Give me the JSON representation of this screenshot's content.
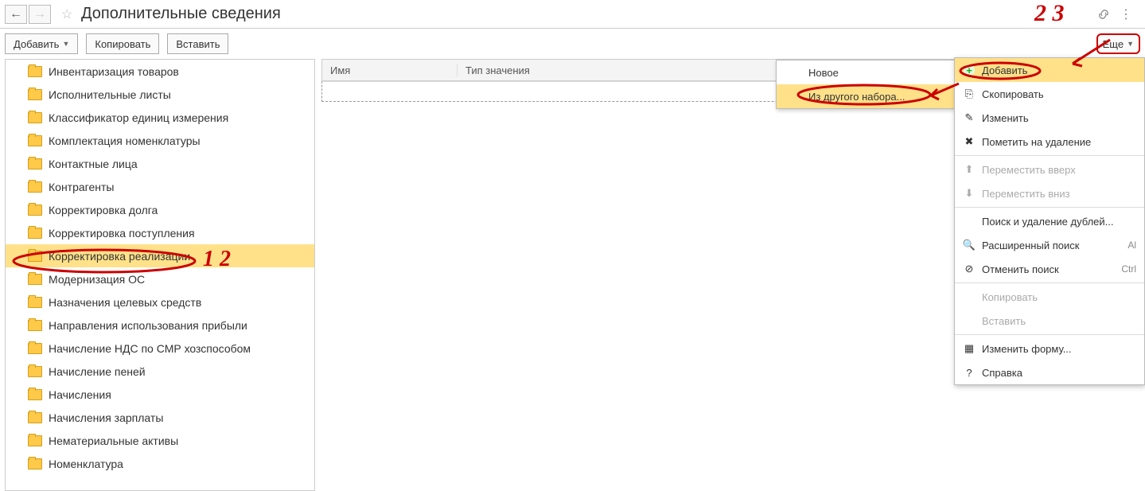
{
  "header": {
    "title": "Дополнительные сведения"
  },
  "toolbar": {
    "add": "Добавить",
    "copy": "Копировать",
    "paste": "Вставить",
    "more": "Еще"
  },
  "sidebar": {
    "items": [
      "Инвентаризация товаров",
      "Исполнительные листы",
      "Классификатор единиц измерения",
      "Комплектация номенклатуры",
      "Контактные лица",
      "Контрагенты",
      "Корректировка долга",
      "Корректировка поступления",
      "Корректировка реализации",
      "Модернизация ОС",
      "Назначения целевых средств",
      "Направления использования прибыли",
      "Начисление НДС по СМР хозспособом",
      "Начисление пеней",
      "Начисления",
      "Начисления зарплаты",
      "Нематериальные активы",
      "Номенклатура"
    ],
    "selected_index": 8
  },
  "table": {
    "col_name": "Имя",
    "col_type": "Тип значения"
  },
  "submenu": {
    "item1": "Новое",
    "item2": "Из другого набора..."
  },
  "context_menu": {
    "items": [
      {
        "label": "Добавить",
        "icon": "plus",
        "hl": true,
        "arrow": true
      },
      {
        "label": "Скопировать",
        "icon": "copy"
      },
      {
        "label": "Изменить",
        "icon": "edit"
      },
      {
        "label": "Пометить на удаление",
        "icon": "delete"
      },
      {
        "sep": true
      },
      {
        "label": "Переместить вверх",
        "icon": "up",
        "disabled": true
      },
      {
        "label": "Переместить вниз",
        "icon": "down",
        "disabled": true
      },
      {
        "sep": true
      },
      {
        "label": "Поиск и удаление дублей..."
      },
      {
        "label": "Расширенный поиск",
        "icon": "search",
        "hotkey": "Al"
      },
      {
        "label": "Отменить поиск",
        "icon": "cancel",
        "hotkey": "Ctrl"
      },
      {
        "sep": true
      },
      {
        "label": "Копировать",
        "disabled": true
      },
      {
        "label": "Вставить",
        "disabled": true
      },
      {
        "sep": true
      },
      {
        "label": "Изменить форму...",
        "icon": "form"
      },
      {
        "label": "Справка",
        "icon": "help"
      }
    ]
  },
  "annotations": {
    "n1": "1 2",
    "n2": "2 3"
  }
}
